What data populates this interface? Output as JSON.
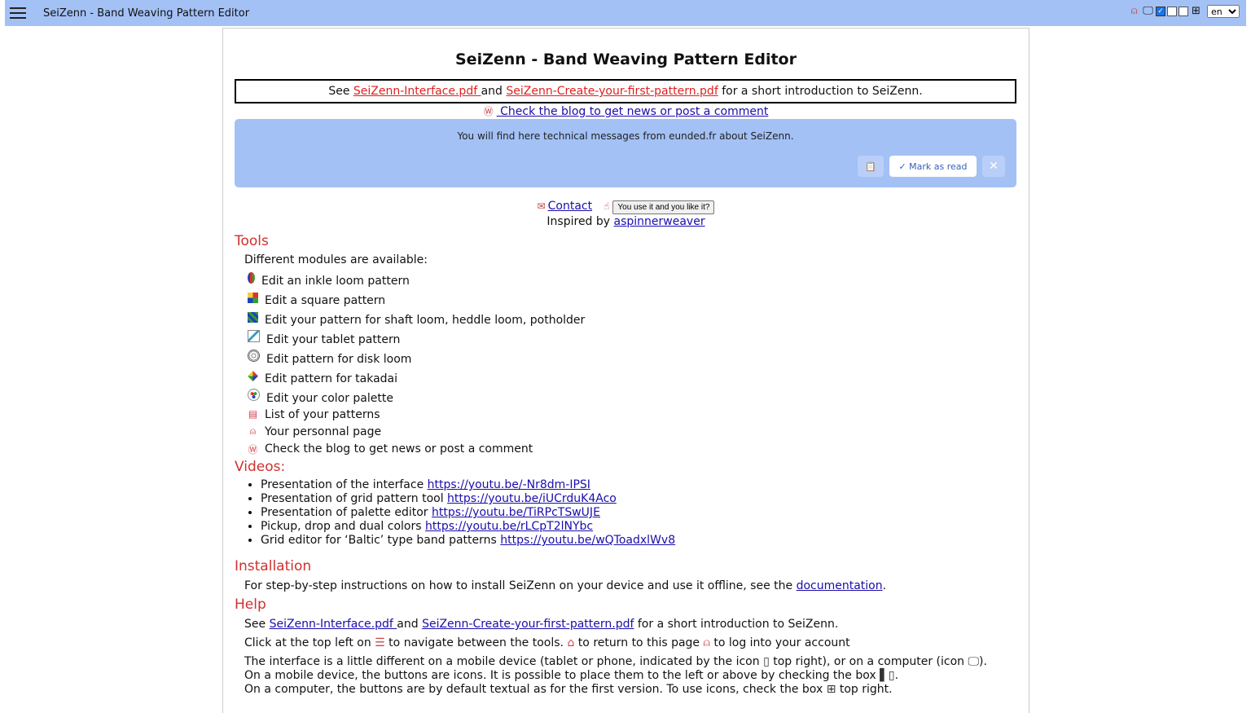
{
  "app": {
    "title": "SeiZenn - Band Weaving Pattern Editor",
    "language": "en",
    "toolbar_icons": [
      "user-icon",
      "computer-icon",
      "checkbox-icon",
      "mobile-side-icon",
      "grid-icon"
    ]
  },
  "colors": {
    "topbar": "#a3c1f5",
    "heading_red": "#d03030",
    "link_red": "#e02020",
    "link_blue": "#1a0dab"
  },
  "main": {
    "heading": "SeiZenn - Band Weaving Pattern Editor",
    "intro": {
      "prefix": "See ",
      "link1": "SeiZenn-Interface.pdf ",
      "and": "and ",
      "link2": "SeiZenn-Create-your-first-pattern.pdf",
      "suffix": " for a short introduction to SeiZenn."
    },
    "blog_link": " Check the blog to get news or post a comment",
    "message": {
      "text": "You will find here technical messages from eunded.fr about SeiZenn.",
      "copy_icon": "📋",
      "mark_read": "✓ Mark as read",
      "close": "✕"
    },
    "contact": {
      "label": "Contact",
      "like_button": "You use it and you like it?",
      "inspired_prefix": "Inspired by ",
      "inspired_link": "aspinnerweaver"
    }
  },
  "tools": {
    "heading": "Tools",
    "intro": "Different modules are available:",
    "items": [
      {
        "label": "Edit an inkle loom pattern",
        "icon": "inkle-icon"
      },
      {
        "label": "Edit a square pattern",
        "icon": "square-pattern-icon"
      },
      {
        "label": "Edit your pattern for shaft loom, heddle loom, potholder",
        "icon": "shaft-loom-icon"
      },
      {
        "label": "Edit your tablet pattern",
        "icon": "tablet-icon"
      },
      {
        "label": "Edit pattern for disk loom",
        "icon": "disk-loom-icon"
      },
      {
        "label": "Edit pattern for takadai",
        "icon": "takadai-icon"
      },
      {
        "label": "Edit your color palette",
        "icon": "palette-icon"
      },
      {
        "label": "List of your patterns",
        "icon": "list-icon"
      },
      {
        "label": "Your personnal page",
        "icon": "user-icon"
      },
      {
        "label": "Check the blog to get news or post a comment",
        "icon": "wordpress-icon"
      }
    ]
  },
  "videos": {
    "heading": "Videos:",
    "items": [
      {
        "label": "Presentation of the interface ",
        "url": "https://youtu.be/-Nr8dm-IPSI"
      },
      {
        "label": "Presentation of grid pattern tool ",
        "url": "https://youtu.be/iUCrduK4Aco"
      },
      {
        "label": "Presentation of palette editor ",
        "url": "https://youtu.be/TiRPcTSwUJE"
      },
      {
        "label": "Pickup, drop and dual colors ",
        "url": "https://youtu.be/rLCpT2lNYbc"
      },
      {
        "label": "Grid editor for ‘Baltic’ type band patterns ",
        "url": "https://youtu.be/wQToadxlWv8"
      }
    ]
  },
  "installation": {
    "heading": "Installation",
    "prefix": "For step-by-step instructions on how to install SeiZenn on your device and use it offline, see the ",
    "link": "documentation",
    "suffix": "."
  },
  "help": {
    "heading": "Help",
    "line1_prefix": "See ",
    "line1_link1": "SeiZenn-Interface.pdf ",
    "line1_and": "and ",
    "line1_link2": "SeiZenn-Create-your-first-pattern.pdf",
    "line1_suffix": " for a short introduction to SeiZenn.",
    "line2_a": "Click at the top left on ",
    "line2_b": " to navigate between the tools. ",
    "line2_c": " to return to this page ",
    "line2_d": " to log into your account",
    "line3_a": "The interface is a little different on a mobile device (tablet or phone, indicated by the icon ",
    "line3_b": " top right), or on a computer (icon ",
    "line3_c": ").",
    "line4_a": "On a mobile device, the buttons are icons. It is possible to place them to the left or above by checking the box ",
    "line4_b": ".",
    "line5_a": "On a computer, the buttons are by default textual as for the first version. To use icons, check the box ",
    "line5_b": " top right."
  }
}
